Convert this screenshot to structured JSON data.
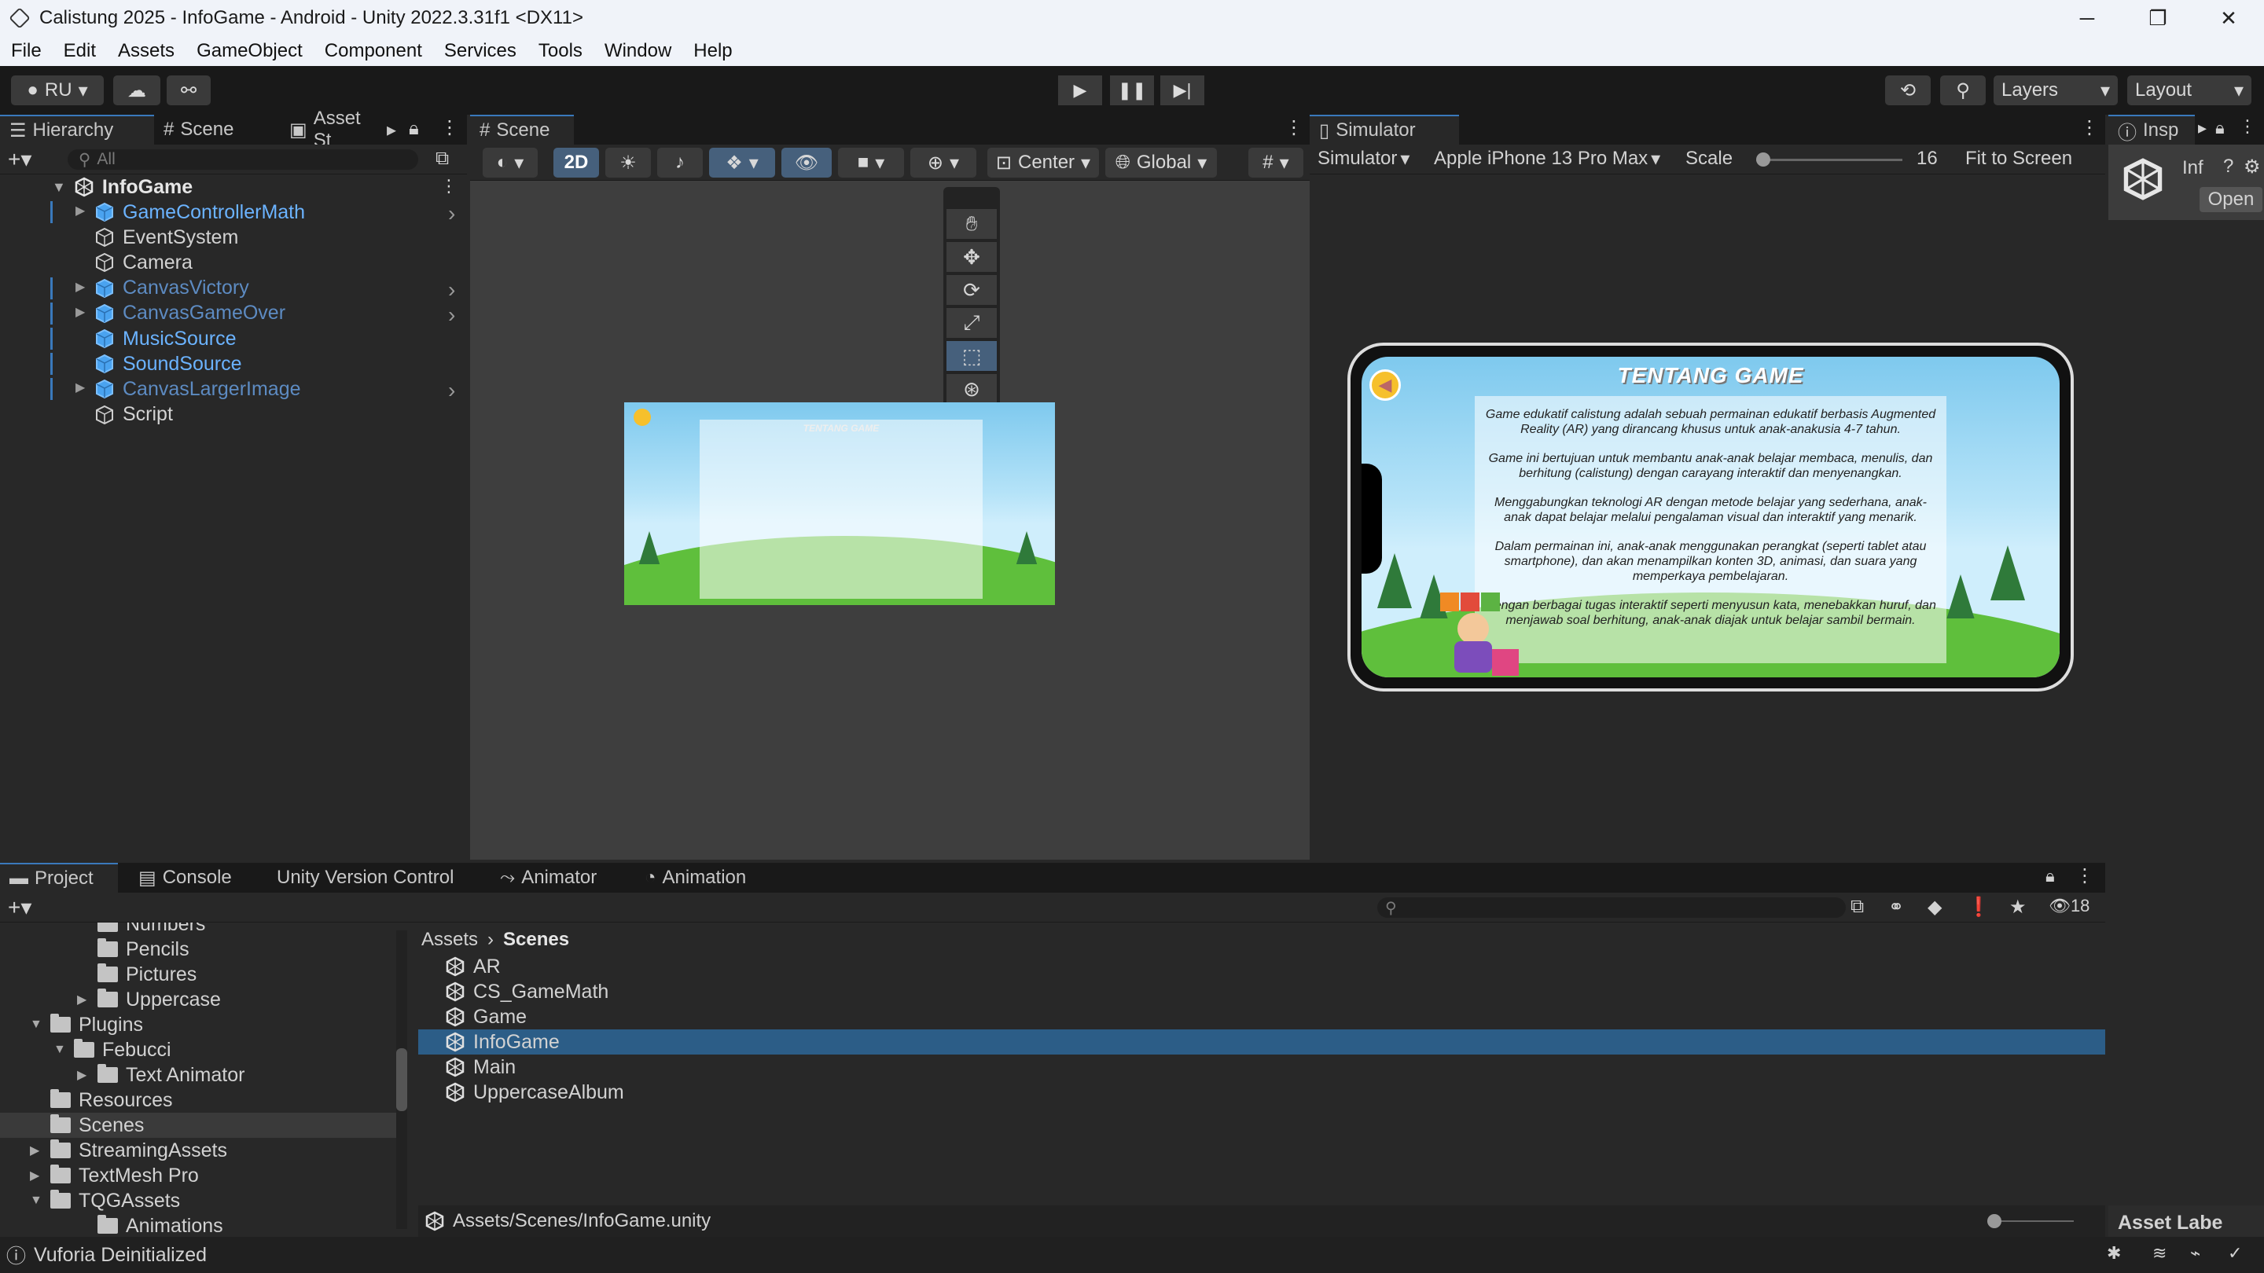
{
  "window": {
    "title": "Calistung 2025 - InfoGame - Android - Unity 2022.3.31f1 <DX11>"
  },
  "menu": [
    "File",
    "Edit",
    "Assets",
    "GameObject",
    "Component",
    "Services",
    "Tools",
    "Window",
    "Help"
  ],
  "toolbar": {
    "account": "RU",
    "layers": "Layers",
    "layout": "Layout"
  },
  "hierarchy": {
    "tabs": {
      "hierarchy": "Hierarchy",
      "scene": "Scene",
      "asset_store": "Asset St"
    },
    "search_placeholder": "All",
    "root": "InfoGame",
    "items": [
      {
        "label": "GameControllerMath",
        "style": "blue",
        "expandable": true
      },
      {
        "label": "EventSystem",
        "style": "normal",
        "expandable": false
      },
      {
        "label": "Camera",
        "style": "normal",
        "expandable": false
      },
      {
        "label": "CanvasVictory",
        "style": "dim",
        "expandable": true
      },
      {
        "label": "CanvasGameOver",
        "style": "dim",
        "expandable": true
      },
      {
        "label": "MusicSource",
        "style": "blue",
        "expandable": false
      },
      {
        "label": "SoundSource",
        "style": "blue",
        "expandable": false
      },
      {
        "label": "CanvasLargerImage",
        "style": "dim",
        "expandable": true
      },
      {
        "label": "Script",
        "style": "normal",
        "expandable": false
      }
    ]
  },
  "scene_view": {
    "tab": "Scene",
    "mode_2d": "2D",
    "pivot": "Center",
    "space": "Global"
  },
  "simulator": {
    "tab": "Simulator",
    "mode": "Simulator",
    "device": "Apple iPhone 13 Pro Max",
    "scale_label": "Scale",
    "scale_value": "16",
    "fit": "Fit to Screen"
  },
  "inspector": {
    "tab": "Insp",
    "label": "Inf",
    "open_button": "Open",
    "footer": "Asset Labe"
  },
  "game": {
    "title": "TENTANG GAME",
    "paragraphs": [
      "Game edukatif calistung adalah sebuah permainan edukatif berbasis Augmented Reality (AR) yang dirancang khusus untuk anak-anakusia 4-7 tahun.",
      "Game ini bertujuan untuk membantu anak-anak belajar membaca, menulis, dan berhitung (calistung) dengan carayang interaktif dan menyenangkan.",
      "Menggabungkan teknologi AR dengan metode belajar yang sederhana, anak-anak dapat belajar melalui pengalaman visual dan interaktif yang menarik.",
      "Dalam permainan ini, anak-anak menggunakan perangkat (seperti tablet atau smartphone), dan akan menampilkan konten 3D, animasi, dan suara yang memperkaya pembelajaran.",
      "Dengan berbagai tugas interaktif seperti menyusun kata, menebakkan huruf, dan menjawab soal berhitung, anak-anak diajak untuk belajar sambil bermain."
    ]
  },
  "bottom": {
    "tabs": [
      "Project",
      "Console",
      "Unity Version Control",
      "Animator",
      "Animation"
    ],
    "count": "18",
    "breadcrumb": [
      "Assets",
      "Scenes"
    ],
    "tree": [
      {
        "label": "Numbers",
        "indent": 3
      },
      {
        "label": "Pencils",
        "indent": 3
      },
      {
        "label": "Pictures",
        "indent": 3
      },
      {
        "label": "Uppercase",
        "indent": 3,
        "arrow": "right"
      },
      {
        "label": "Plugins",
        "indent": 1,
        "arrow": "down"
      },
      {
        "label": "Febucci",
        "indent": 2,
        "arrow": "down"
      },
      {
        "label": "Text Animator",
        "indent": 3,
        "arrow": "right"
      },
      {
        "label": "Resources",
        "indent": 1
      },
      {
        "label": "Scenes",
        "indent": 1,
        "selected": true
      },
      {
        "label": "StreamingAssets",
        "indent": 1,
        "arrow": "right"
      },
      {
        "label": "TextMesh Pro",
        "indent": 1,
        "arrow": "right"
      },
      {
        "label": "TQGAssets",
        "indent": 1,
        "arrow": "down"
      },
      {
        "label": "Animations",
        "indent": 3
      }
    ],
    "scenes": [
      "AR",
      "CS_GameMath",
      "Game",
      "InfoGame",
      "Main",
      "UppercaseAlbum"
    ],
    "selected_scene": "InfoGame",
    "path": "Assets/Scenes/InfoGame.unity"
  },
  "status": {
    "message": "Vuforia Deinitialized"
  }
}
